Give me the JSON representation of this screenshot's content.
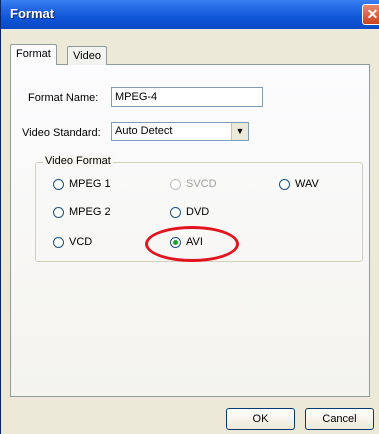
{
  "window": {
    "title": "Format",
    "close_glyph": "✕"
  },
  "tabs": [
    {
      "label": "Format",
      "selected": true
    },
    {
      "label": "Video",
      "selected": false
    }
  ],
  "form": {
    "format_name_label": "Format Name:",
    "format_name_value": "MPEG-4",
    "video_standard_label": "Video Standard:",
    "video_standard_value": "Auto Detect",
    "dropdown_arrow": "▼"
  },
  "video_format": {
    "group_label": "Video Format",
    "options": [
      {
        "label": "MPEG 1",
        "selected": false,
        "enabled": true
      },
      {
        "label": "SVCD",
        "selected": false,
        "enabled": false
      },
      {
        "label": "WAV",
        "selected": false,
        "enabled": true
      },
      {
        "label": "MPEG 2",
        "selected": false,
        "enabled": true
      },
      {
        "label": "DVD",
        "selected": false,
        "enabled": true
      },
      {
        "label": "VCD",
        "selected": false,
        "enabled": true
      },
      {
        "label": "AVI",
        "selected": true,
        "enabled": true
      }
    ],
    "highlight_color": "#e3141c"
  },
  "buttons": {
    "ok": "OK",
    "cancel": "Cancel"
  }
}
